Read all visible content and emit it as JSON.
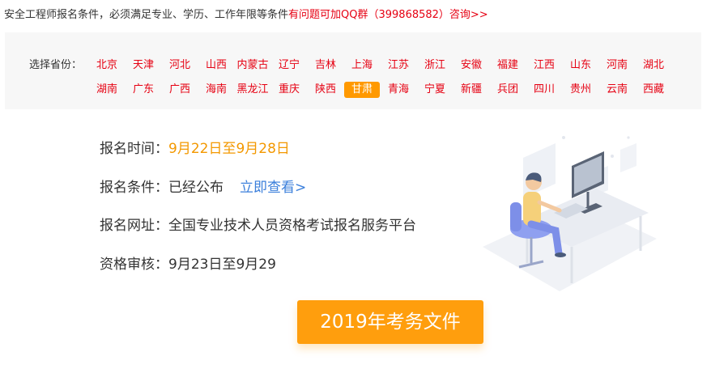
{
  "notice": {
    "text": "安全工程师报名条件，必须满足专业、学历、工作年限等条件",
    "highlight": "有问题可加QQ群（399868582）咨询>>"
  },
  "province_selector": {
    "label": "选择省份：",
    "active": "甘肃",
    "row1": [
      "北京",
      "天津",
      "河北",
      "山西",
      "内蒙古",
      "辽宁",
      "吉林",
      "上海",
      "江苏",
      "浙江",
      "安徽",
      "福建",
      "江西",
      "山东",
      "河南",
      "湖北"
    ],
    "row2": [
      "湖南",
      "广东",
      "广西",
      "海南",
      "黑龙江",
      "重庆",
      "陕西",
      "甘肃",
      "青海",
      "宁夏",
      "新疆",
      "兵团",
      "四川",
      "贵州",
      "云南",
      "西藏"
    ]
  },
  "info": {
    "time_label": "报名时间：",
    "time_value": "9月22日至9月28日",
    "condition_label": "报名条件：",
    "condition_value": "已经公布",
    "condition_link": "立即查看>",
    "website_label": "报名网址：",
    "website_value": "全国专业技术人员资格考试报名服务平台",
    "review_label": "资格审核：",
    "review_value": "9月23日至9月29"
  },
  "button_label": "2019年考务文件",
  "colors": {
    "accent_red": "#e60012",
    "accent_orange": "#ff9e0d",
    "link_blue": "#3b7fdb",
    "panel_bg": "#f7f7f7"
  }
}
